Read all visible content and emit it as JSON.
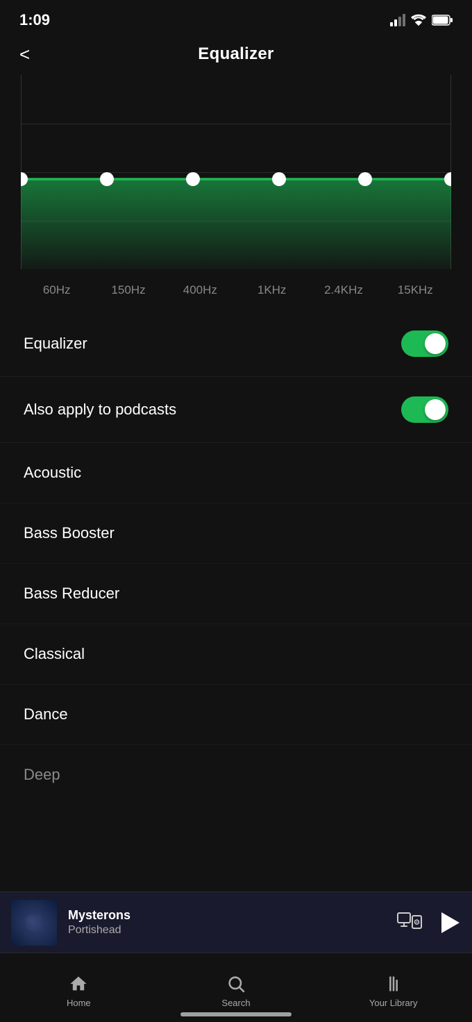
{
  "statusBar": {
    "time": "1:09"
  },
  "header": {
    "title": "Equalizer",
    "backLabel": "<"
  },
  "eqChart": {
    "frequencies": [
      "60Hz",
      "150Hz",
      "400Hz",
      "1KHz",
      "2.4KHz",
      "15KHz"
    ],
    "pointsFlat": true,
    "lineColor": "#1db954",
    "fillColor": "rgba(29,185,84,0.3)"
  },
  "toggles": [
    {
      "label": "Equalizer",
      "enabled": true
    },
    {
      "label": "Also apply to podcasts",
      "enabled": true
    }
  ],
  "presets": [
    {
      "label": "Acoustic"
    },
    {
      "label": "Bass Booster"
    },
    {
      "label": "Bass Reducer"
    },
    {
      "label": "Classical"
    },
    {
      "label": "Dance"
    },
    {
      "label": "Deep"
    }
  ],
  "nowPlaying": {
    "title": "Mysterons",
    "artist": "Portishead"
  },
  "bottomNav": {
    "items": [
      {
        "label": "Home",
        "active": false
      },
      {
        "label": "Search",
        "active": false
      },
      {
        "label": "Your Library",
        "active": false
      }
    ]
  }
}
